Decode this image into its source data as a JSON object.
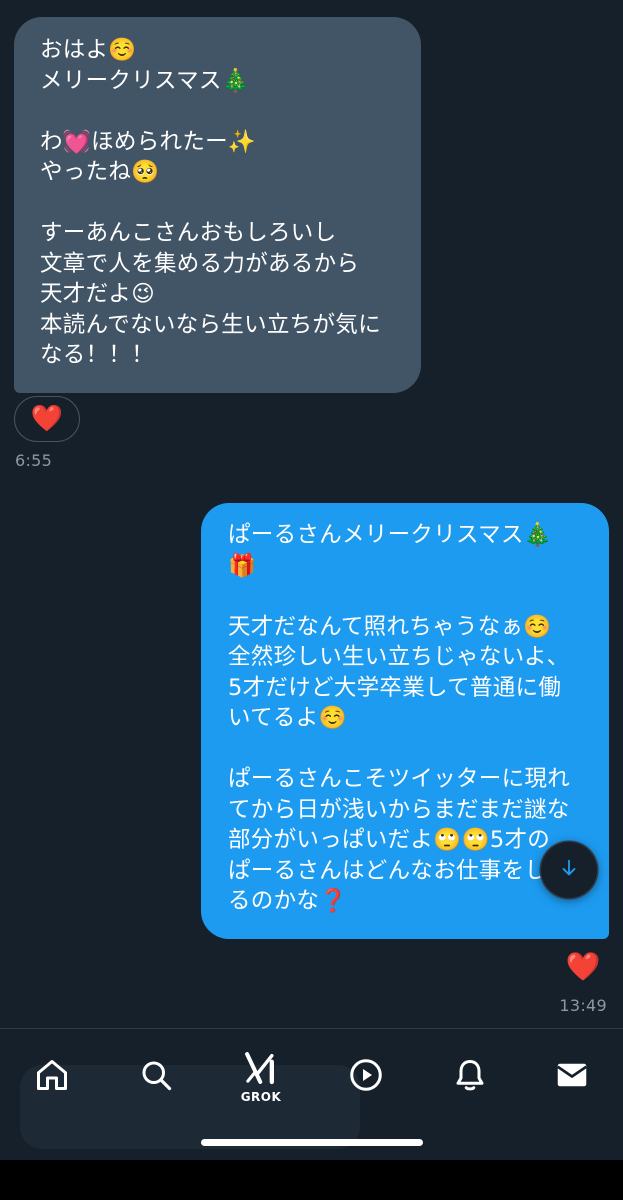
{
  "messages": [
    {
      "direction": "incoming",
      "text": "おはよ☺️\nメリークリスマス🎄\n\nわ💓ほめられたー✨\nやったね🥺\n\nすーあんこさんおもしろいし\n文章で人を集める力があるから\n天才だよ😉\n本読んでないなら生い立ちが気に\nなる！！！",
      "reaction": "❤️",
      "time": "6:55"
    },
    {
      "direction": "outgoing",
      "text": "ぱーるさんメリークリスマス🎄\n🎁\n\n天才だなんて照れちゃうなぁ☺️\n全然珍しい生い立ちじゃないよ、\n5才だけど大学卒業して普通に働\nいてるよ☺️\n\nぱーるさんこそツイッターに現れ\nてから日が浅いからまだまだ謎な\n部分がいっぱいだよ🙄🙄5才の\nぱーるさんはどんなお仕事をして\nるのかな❓",
      "reaction": "❤️",
      "time": "13:49"
    }
  ],
  "nav": {
    "items": [
      {
        "id": "home",
        "icon": "home-icon"
      },
      {
        "id": "search",
        "icon": "search-icon"
      },
      {
        "id": "grok",
        "icon": "grok-icon",
        "label": "GROK"
      },
      {
        "id": "video",
        "icon": "play-circle-icon"
      },
      {
        "id": "notifications",
        "icon": "bell-icon"
      },
      {
        "id": "messages",
        "icon": "envelope-icon"
      }
    ]
  },
  "colors": {
    "background": "#15202b",
    "incoming_bubble": "#425566",
    "outgoing_bubble": "#1d9bf0",
    "timestamp": "#8b98a5",
    "accent": "#1d9bf0"
  },
  "scroll_button": {
    "icon": "arrow-down-icon"
  }
}
